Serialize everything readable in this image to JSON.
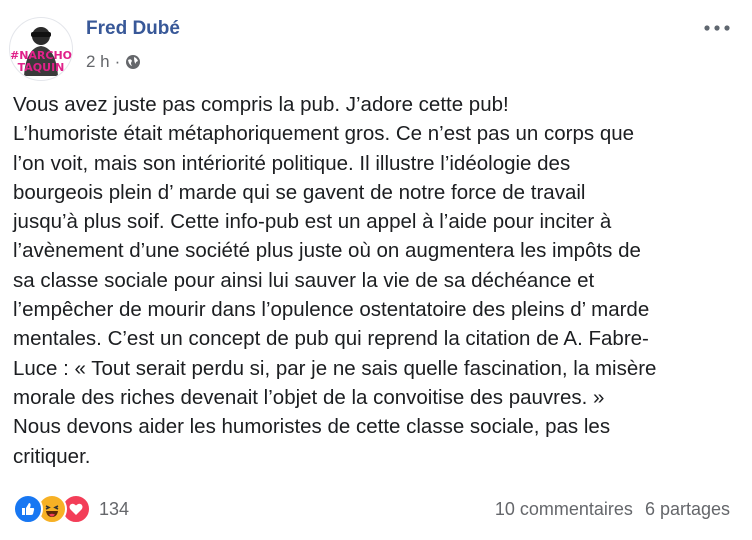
{
  "post": {
    "author": "Fred Dubé",
    "avatar_text": "ANARCHO TAQUIN",
    "time": "2 h",
    "separator": "·",
    "privacy_icon": "globe-icon",
    "more_icon": "more-horizontal-icon",
    "text_lines": [
      "Vous avez juste pas compris la pub. J’adore cette pub!",
      "L’humoriste était métaphoriquement gros. Ce n’est pas un corps que",
      "l’on voit, mais son intériorité politique. Il illustre l’idéologie des",
      "bourgeois plein d’ marde qui se gavent de notre force de travail",
      "jusqu’à plus soif. Cette info-pub est un appel à l’aide pour inciter à",
      "l’avènement d’une société plus juste où on augmentera les impôts de",
      "sa classe sociale pour ainsi lui sauver la vie de sa déchéance et",
      "l’empêcher de mourir dans l’opulence ostentatoire des pleins d’ marde",
      "mentales. C’est un concept de pub qui reprend la citation de A. Fabre-",
      "Luce : « Tout serait perdu si, par je ne sais quelle fascination, la misère",
      "morale des riches devenait l’objet de la convoitise des pauvres. »",
      "Nous devons aider les humoristes de cette classe sociale, pas les",
      "critiquer."
    ]
  },
  "footer": {
    "reactions": [
      "like-icon",
      "haha-icon",
      "love-icon"
    ],
    "reaction_count": "134",
    "comments": "10 commentaires",
    "shares": "6 partages"
  },
  "colors": {
    "author": "#385898",
    "meta": "#65676b",
    "text": "#1c1e21",
    "like": "#1877f2",
    "haha": "#f7b125",
    "love": "#f33e58",
    "avatar_ink": "#e0218a"
  }
}
